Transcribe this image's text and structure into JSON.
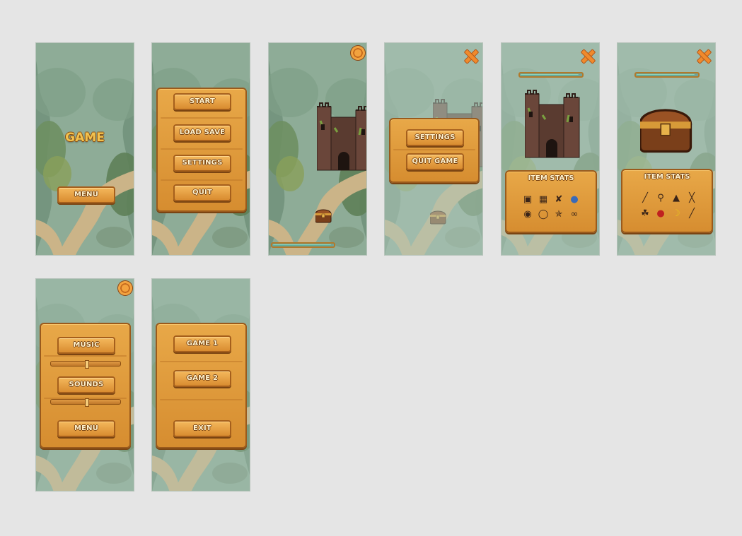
{
  "screens": {
    "title": {
      "title": "GAME",
      "menu_label": "MENU"
    },
    "main_menu": {
      "start_label": "START",
      "load_label": "LOAD SAVE",
      "settings_label": "SETTINGS",
      "quit_label": "QUIT"
    },
    "pause": {
      "settings_label": "SETTINGS",
      "quit_label": "QUIT GAME"
    },
    "item_stats_castle": {
      "title": "ITEM STATS",
      "icons": [
        "book-icon",
        "spellbook-icon",
        "bone-icon",
        "potion-icon",
        "lips-icon",
        "ring-icon",
        "necklace-icon",
        "rope-icon"
      ]
    },
    "item_stats_chest": {
      "title": "ITEM STATS",
      "icons": [
        "wand-icon",
        "magnifier-icon",
        "lock-icon",
        "staff-icon",
        "ribbon-icon",
        "apple-icon",
        "banana-icon",
        "sword-icon"
      ]
    },
    "sound_settings": {
      "music_label": "MUSIC",
      "sounds_label": "SOUNDS",
      "menu_label": "MENU"
    },
    "game_select": {
      "game1_label": "GAME 1",
      "game2_label": "GAME 2",
      "exit_label": "EXIT"
    }
  },
  "progress": {
    "castle_view": 0.97,
    "item_stats_castle": 0.95,
    "item_stats_chest": 0.95
  },
  "colors": {
    "wood": "#d98c30",
    "wood_dark": "#9a5a1c",
    "text_cream": "#fff3cf",
    "title_gold": "#f2c24e",
    "bar_fill": "#4aa08c",
    "close_orange": "#f08a2c",
    "forest": "#8aa893"
  }
}
